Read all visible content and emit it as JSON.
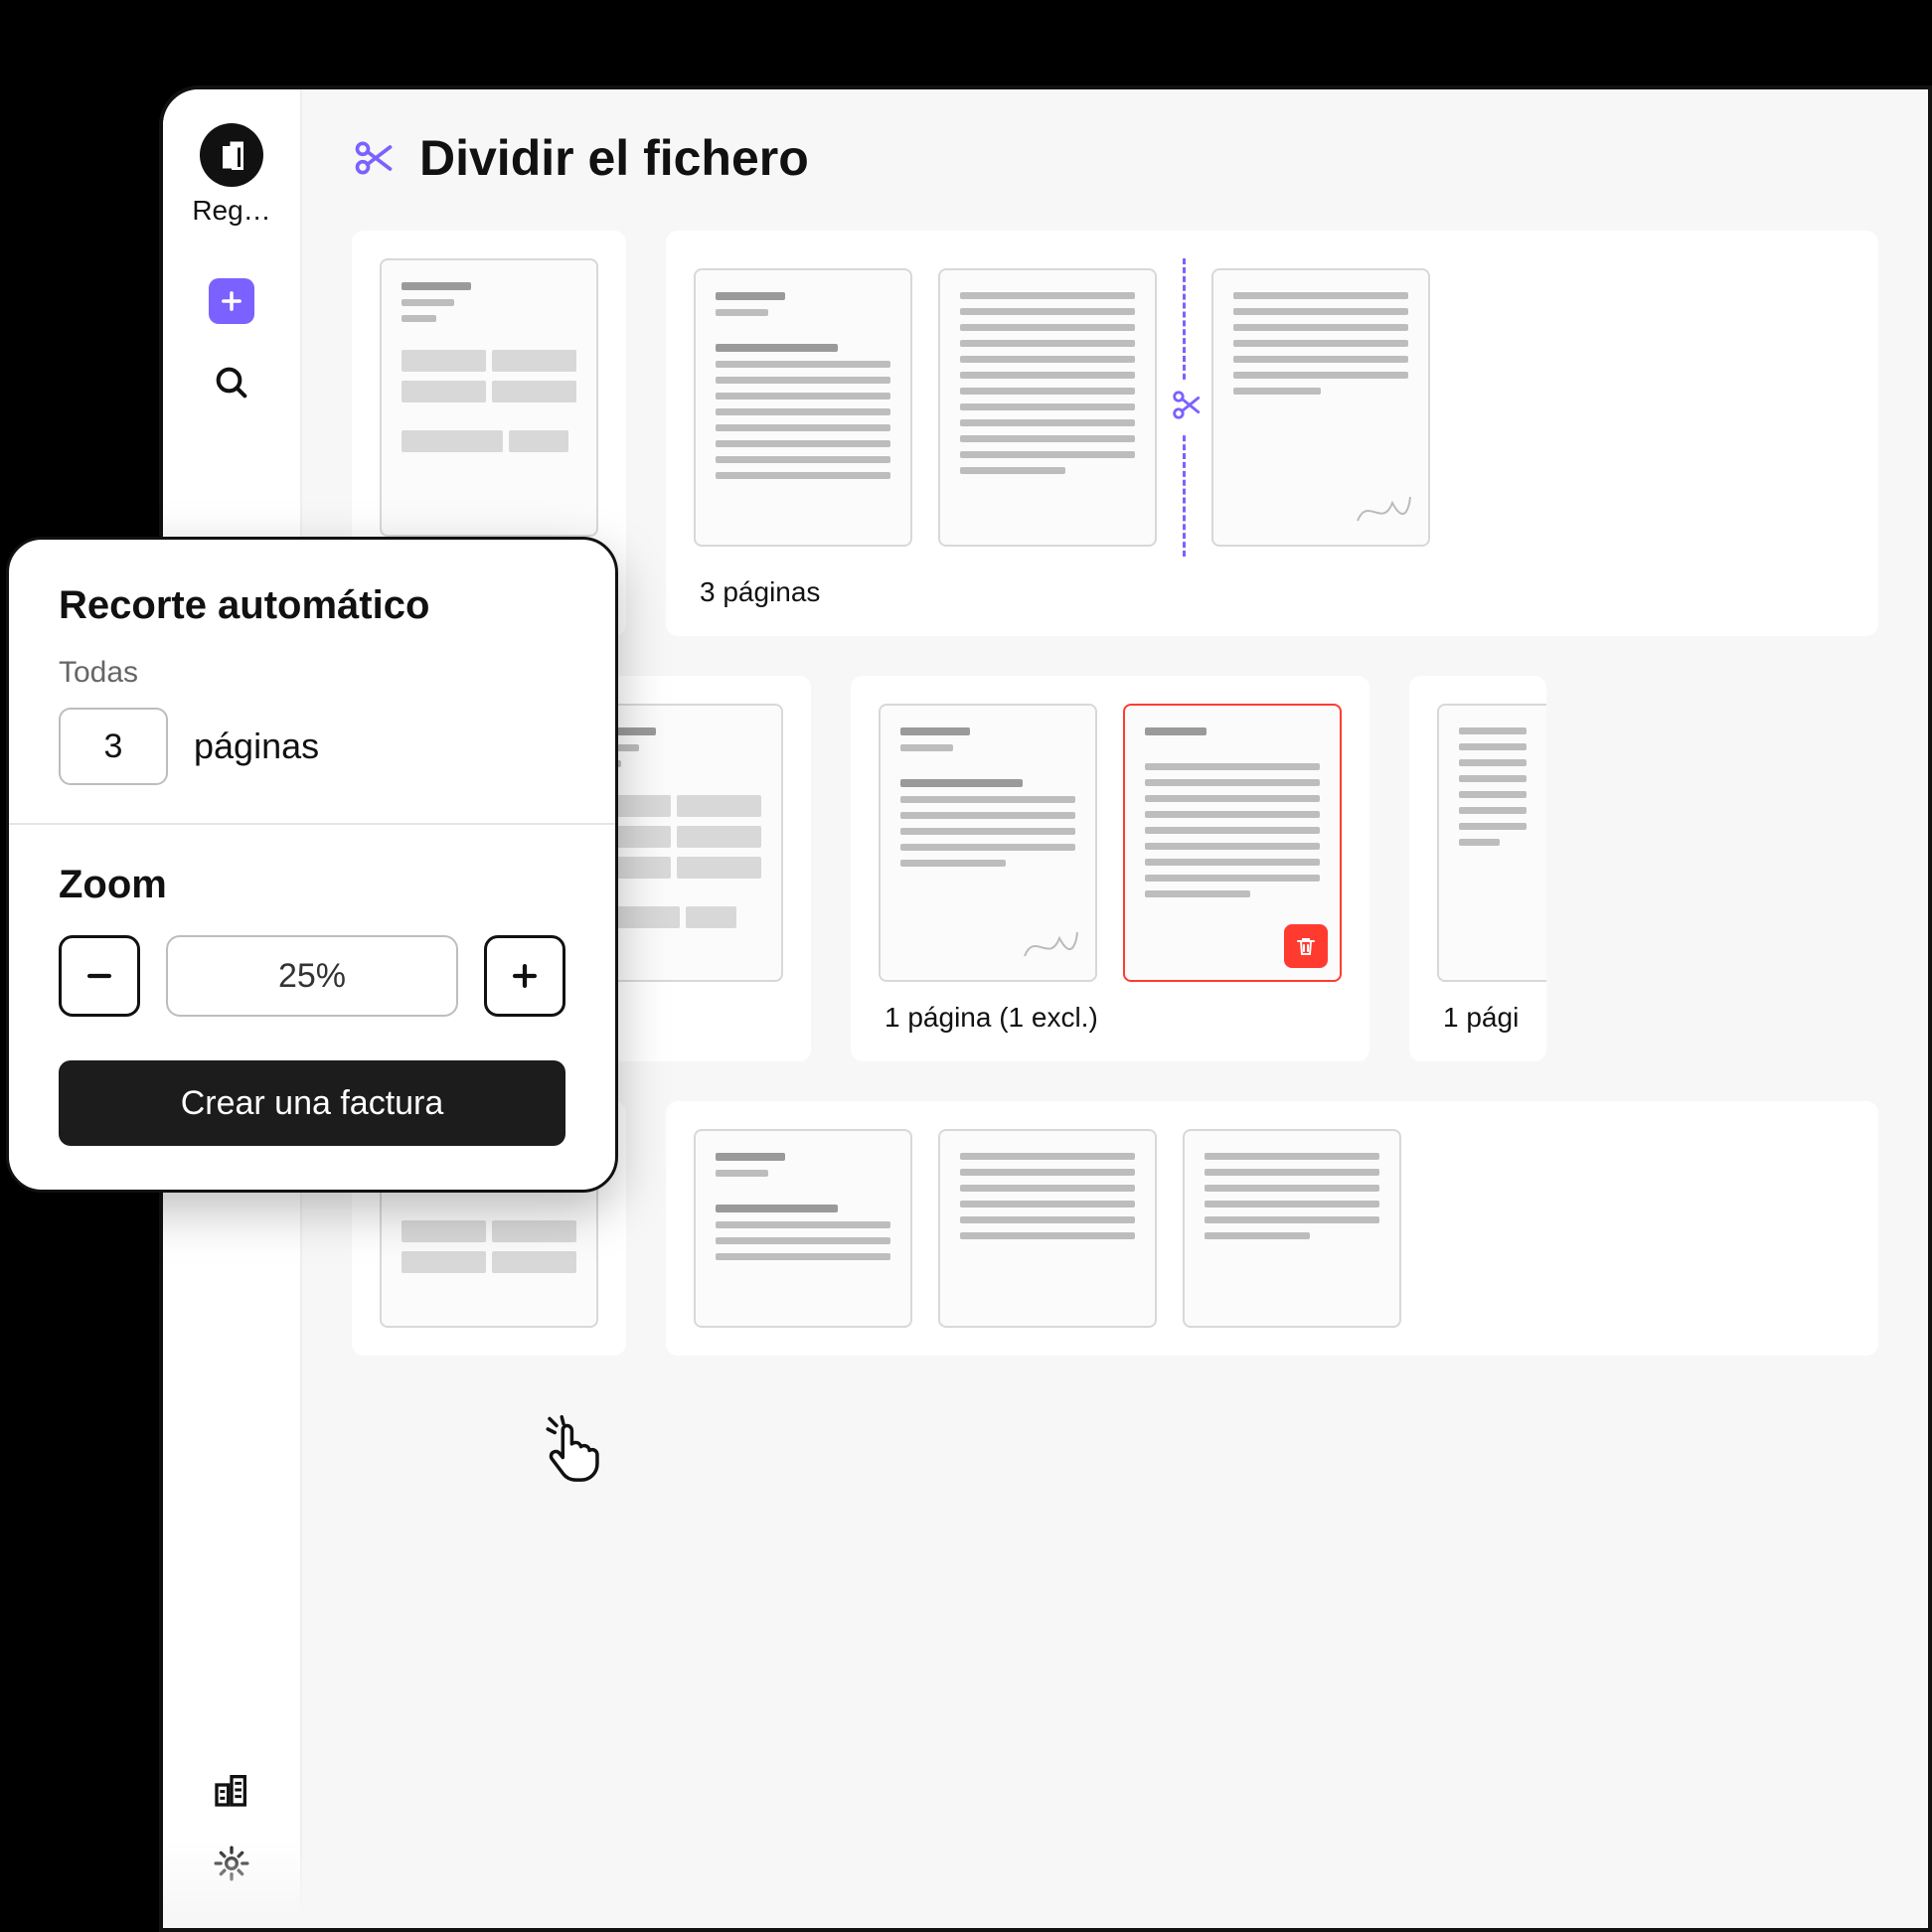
{
  "colors": {
    "accent": "#7B61FF",
    "danger": "#ff3b30"
  },
  "sidebar": {
    "brand_label": "Reg…",
    "icons": {
      "add": "add-icon",
      "search": "search-icon",
      "company": "company-icon",
      "settings": "gear-icon"
    }
  },
  "header": {
    "title": "Dividir el fichero"
  },
  "groups": {
    "row1": {
      "g0_caption": "",
      "g1_caption": "3 páginas"
    },
    "row2": {
      "g0_caption": "",
      "g1_caption": "1 página (1 excl.)",
      "g2_caption": "1 pági"
    }
  },
  "popover": {
    "title": "Recorte automático",
    "all_label": "Todas",
    "pages_value": "3",
    "pages_suffix": "páginas",
    "zoom_label": "Zoom",
    "zoom_value": "25%",
    "cta": "Crear una factura"
  }
}
